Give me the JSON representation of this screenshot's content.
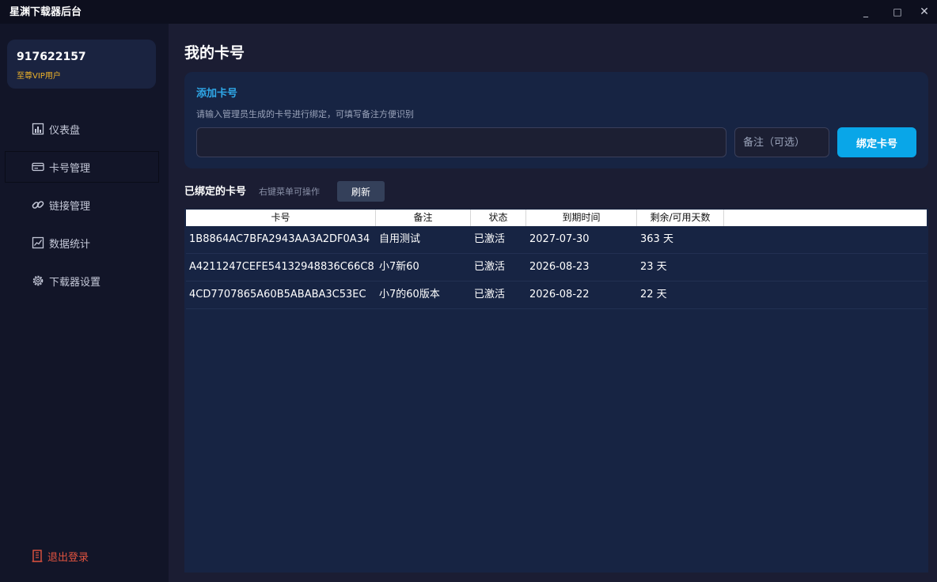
{
  "window": {
    "title": "星渊下载器后台",
    "minimize": "_",
    "maximize": "□",
    "close": "✕"
  },
  "user": {
    "id": "917622157",
    "level": "至尊VIP用户"
  },
  "sidebar": {
    "items": [
      {
        "label": "仪表盘",
        "icon": "bar-chart-icon"
      },
      {
        "label": "卡号管理",
        "icon": "card-icon"
      },
      {
        "label": "链接管理",
        "icon": "link-icon"
      },
      {
        "label": "数据统计",
        "icon": "line-chart-icon"
      },
      {
        "label": "下载器设置",
        "icon": "gear-icon"
      }
    ],
    "logout": "退出登录"
  },
  "main": {
    "title": "我的卡号",
    "add": {
      "title": "添加卡号",
      "desc": "请输入管理员生成的卡号进行绑定，可填写备注方便识别",
      "card_value": "",
      "note_placeholder": "备注（可选）",
      "bind_label": "绑定卡号"
    },
    "bound": {
      "title": "已绑定的卡号",
      "hint": "右键菜单可操作",
      "refresh_label": "刷新"
    },
    "table": {
      "headers": [
        "卡号",
        "备注",
        "状态",
        "到期时间",
        "剩余/可用天数",
        ""
      ],
      "rows": [
        [
          "1B8864AC7BFA2943AA3A2DF0A34",
          "自用测试",
          "已激活",
          "2027-07-30",
          "363 天"
        ],
        [
          "A4211247CEFE54132948836C66C8",
          "小7新60",
          "已激活",
          "2026-08-23",
          "23 天"
        ],
        [
          "4CD7707865A60B5ABABA3C53EC",
          "小7的60版本",
          "已激活",
          "2026-08-22",
          "22 天"
        ]
      ]
    }
  },
  "colors": {
    "accent": "#09a6e8",
    "vip": "#f0b429",
    "logout": "#e0533f"
  }
}
